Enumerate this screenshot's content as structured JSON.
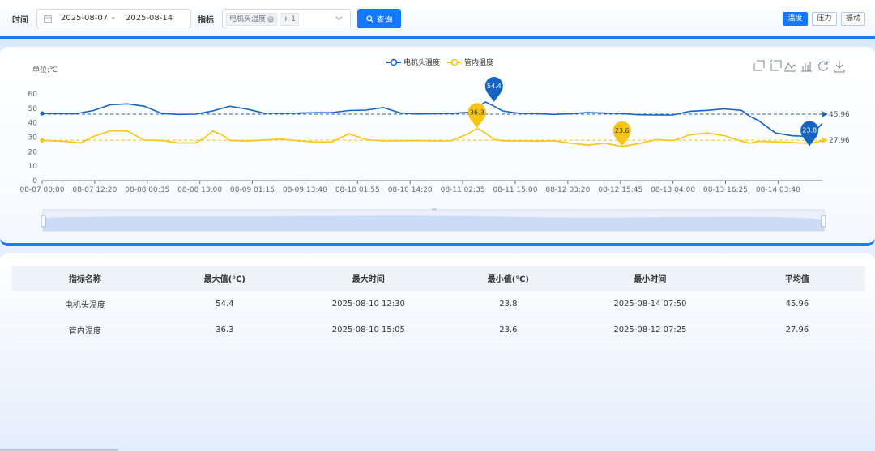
{
  "filters": {
    "time_label": "时间",
    "date_start": "2025-08-07",
    "date_separator": "-",
    "date_end": "2025-08-14",
    "metric_label": "指标",
    "metric_tag": "电机头温度",
    "metric_more": "+ 1",
    "query_button": "查询"
  },
  "view_toggle": {
    "options": [
      "温度",
      "压力",
      "振动"
    ],
    "active": "温度"
  },
  "chart_data": {
    "type": "line",
    "unit_label": "单位:℃",
    "y_ticks": [
      "0",
      "10",
      "20",
      "30",
      "40",
      "50",
      "60"
    ],
    "ylim": [
      0,
      60
    ],
    "x_ticks": [
      "08-07 00:00",
      "08-07 12:20",
      "08-08 00:35",
      "08-08 13:00",
      "08-09 01:15",
      "08-09 13:40",
      "08-10 01:55",
      "08-10 14:20",
      "08-11 02:35",
      "08-11 15:00",
      "08-12 03:20",
      "08-12 15:45",
      "08-13 04:00",
      "08-13 16:25",
      "08-14 03:40"
    ],
    "x_range_hours": [
      0,
      183
    ],
    "legend_position": "top-center",
    "grid": false,
    "series": [
      {
        "name": "电机头温度",
        "color": "#1565c0",
        "x_hours": [
          0,
          4,
          8,
          12,
          16,
          20,
          24,
          28,
          32,
          36,
          40,
          44,
          48,
          52,
          56,
          60,
          64,
          68,
          72,
          76,
          80,
          84,
          88,
          92,
          96,
          100,
          104,
          106,
          108,
          112,
          116,
          120,
          124,
          128,
          132,
          136,
          140,
          144,
          148,
          152,
          156,
          160,
          164,
          166,
          168,
          172,
          176,
          180,
          183
        ],
        "values": [
          46.5,
          46.4,
          46.3,
          48.5,
          52.5,
          53.1,
          51.4,
          46.5,
          45.8,
          46.0,
          48.2,
          51.4,
          49.5,
          46.7,
          46.6,
          46.7,
          47.0,
          47.1,
          48.5,
          48.8,
          50.5,
          46.8,
          46.1,
          46.3,
          46.5,
          47.2,
          54.4,
          51.5,
          48.2,
          46.5,
          46.4,
          45.8,
          46.3,
          47.1,
          46.7,
          46.4,
          45.6,
          45.4,
          45.5,
          48.0,
          48.6,
          49.6,
          48.6,
          44.5,
          41.6,
          33.0,
          31.0,
          30.6,
          39.6
        ]
      },
      {
        "name": "管内温度",
        "color": "#f5c518",
        "x_hours": [
          0,
          6,
          9,
          12,
          16,
          20,
          24,
          28,
          32,
          36,
          38,
          40,
          42,
          44,
          48,
          52,
          56,
          60,
          64,
          68,
          72,
          76,
          80,
          84,
          88,
          92,
          96,
          100,
          102,
          104,
          106,
          108,
          112,
          116,
          120,
          124,
          128,
          132,
          136,
          140,
          144,
          148,
          152,
          156,
          160,
          164,
          166,
          168,
          172,
          176,
          180,
          183
        ],
        "values": [
          27.9,
          27.0,
          26.0,
          30.5,
          34.5,
          34.3,
          28.0,
          27.8,
          26.0,
          26.2,
          29.3,
          34.3,
          32.0,
          27.8,
          27.4,
          28.1,
          28.7,
          27.6,
          26.7,
          26.8,
          32.5,
          28.3,
          27.6,
          27.6,
          27.7,
          27.5,
          27.6,
          32.5,
          36.3,
          32.9,
          28.4,
          27.6,
          27.4,
          27.3,
          27.6,
          25.9,
          24.6,
          25.9,
          23.6,
          25.6,
          28.4,
          27.7,
          31.7,
          32.9,
          31.1,
          27.3,
          25.9,
          27.2,
          26.8,
          26.4,
          25.6,
          27.6
        ]
      }
    ],
    "max_markers": [
      {
        "series": "电机头温度",
        "label": "54.4",
        "x_hour": 106,
        "value": 54.4
      },
      {
        "series": "管内温度",
        "label": "36.3",
        "x_hour": 102,
        "value": 36.3
      }
    ],
    "min_markers": [
      {
        "series": "电机头温度",
        "label": "23.8",
        "x_hour": 180,
        "value": 23.8
      },
      {
        "series": "管内温度",
        "label": "23.6",
        "x_hour": 136,
        "value": 23.6
      }
    ],
    "avg_lines": [
      {
        "series": "电机头温度",
        "label": "45.96",
        "value": 45.96
      },
      {
        "series": "管内温度",
        "label": "27.96",
        "value": 27.96
      }
    ]
  },
  "stats_table": {
    "headers": [
      "指标名称",
      "最大值(℃)",
      "最大时间",
      "最小值(℃)",
      "最小时间",
      "平均值"
    ],
    "rows": [
      [
        "电机头温度",
        "54.4",
        "2025-08-10 12:30",
        "23.8",
        "2025-08-14 07:50",
        "45.96"
      ],
      [
        "管内温度",
        "36.3",
        "2025-08-10 15:05",
        "23.6",
        "2025-08-12 07:25",
        "27.96"
      ]
    ]
  }
}
